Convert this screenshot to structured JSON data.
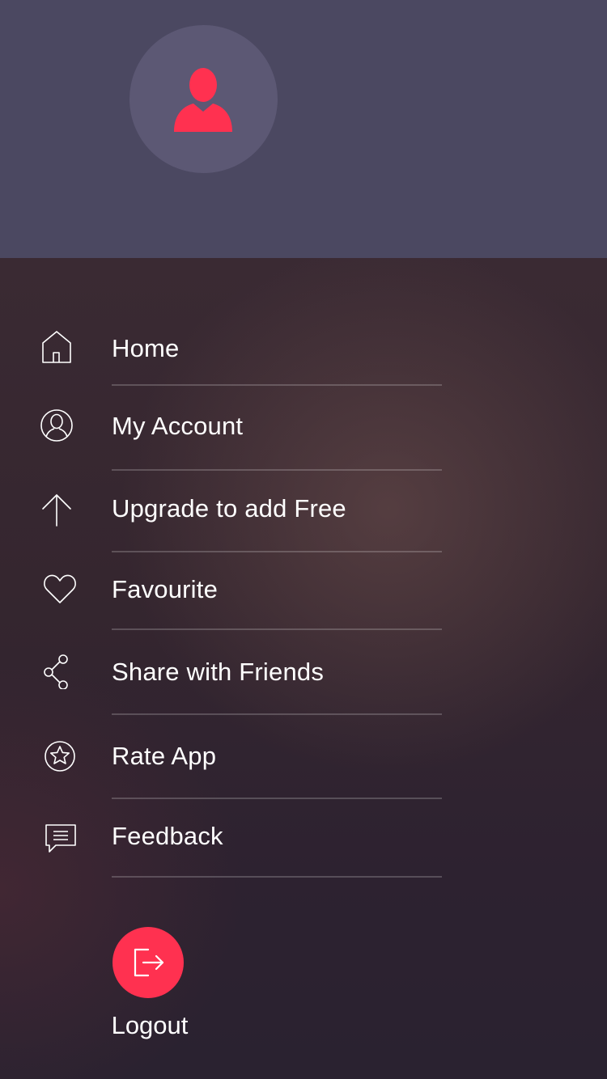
{
  "colors": {
    "header_bg": "#4b4861",
    "avatar_bg": "#5c5874",
    "accent": "#ff3150",
    "text": "#ffffff"
  },
  "profile": {
    "avatar_icon": "user-silhouette-icon"
  },
  "menu": {
    "items": [
      {
        "id": "home",
        "icon": "home-icon",
        "label": "Home"
      },
      {
        "id": "account",
        "icon": "user-circle-icon",
        "label": "My Account"
      },
      {
        "id": "upgrade",
        "icon": "arrow-up-icon",
        "label": "Upgrade to add Free"
      },
      {
        "id": "favourite",
        "icon": "heart-icon",
        "label": "Favourite"
      },
      {
        "id": "share",
        "icon": "share-icon",
        "label": "Share with Friends"
      },
      {
        "id": "rate",
        "icon": "star-circle-icon",
        "label": "Rate App"
      },
      {
        "id": "feedback",
        "icon": "chat-bubble-icon",
        "label": "Feedback"
      }
    ]
  },
  "logout": {
    "icon": "logout-icon",
    "label": "Logout"
  }
}
